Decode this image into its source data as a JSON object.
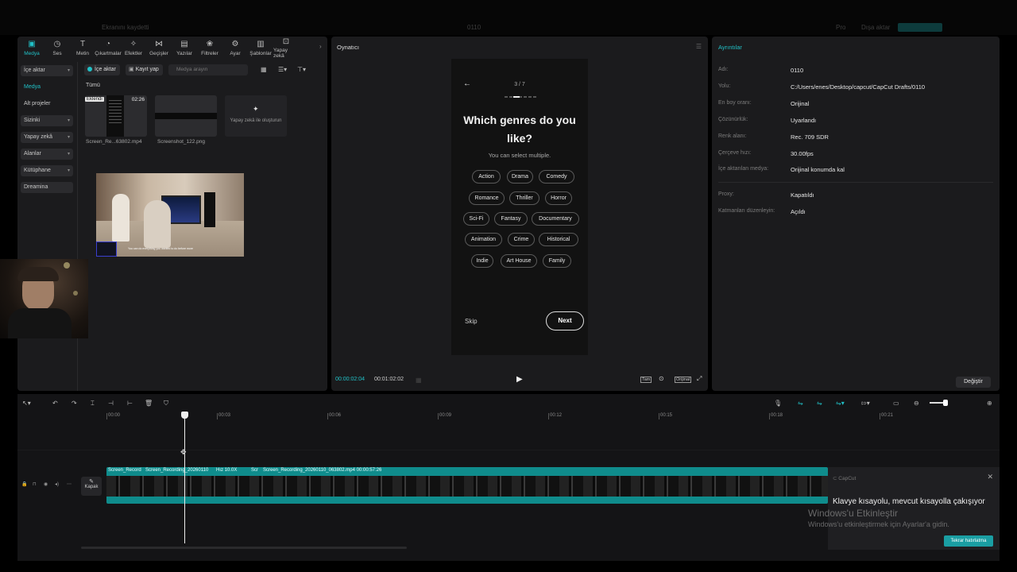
{
  "topbar": {
    "title": "Ekranını kaydetti",
    "center": "0110",
    "badge_pro": "Pro",
    "badge_two": "Dışa aktar"
  },
  "toolbar": [
    {
      "label": "Medya",
      "icon": "media-icon",
      "active": true
    },
    {
      "label": "Ses",
      "icon": "audio-icon"
    },
    {
      "label": "Metin",
      "icon": "text-icon"
    },
    {
      "label": "Çıkartmalar",
      "icon": "sticker-icon"
    },
    {
      "label": "Efektler",
      "icon": "effects-icon"
    },
    {
      "label": "Geçişler",
      "icon": "transitions-icon"
    },
    {
      "label": "Yazılar",
      "icon": "captions-icon"
    },
    {
      "label": "Filtreler",
      "icon": "filters-icon"
    },
    {
      "label": "Ayar",
      "icon": "adjust-icon"
    },
    {
      "label": "Şablonlar",
      "icon": "templates-icon"
    },
    {
      "label": "Yapay zekâ",
      "icon": "ai-icon"
    }
  ],
  "sidebar": {
    "items": [
      "İçe aktar",
      "Medya",
      "Alt projeler",
      "Sizinki",
      "Yapay zekâ",
      "Alanlar",
      "Kütüphane",
      "Dreamina"
    ]
  },
  "media": {
    "import_button": "İçe aktar",
    "record_button": "Kayıt yap",
    "search_placeholder": "Medya arayın",
    "filter_all": "Tümü",
    "item1": {
      "badge": "Eklendi",
      "duration": "02:26",
      "name": "Screen_Re...63802.mp4"
    },
    "item2": {
      "name": "Screenshot_122.png"
    },
    "ai_create": "Yapay zekâ ile oluşturun",
    "preview_caption": "You can do everything you wanted to do before more"
  },
  "player": {
    "title": "Oynatıcı",
    "time_current": "00:00:02:04",
    "time_total": "00:01:02:02",
    "full_label": "Tam",
    "ratio_label": "Orijinal"
  },
  "app_screen": {
    "step": "3 / 7",
    "title_line1": "Which genres do you",
    "title_line2": "like?",
    "subtitle": "You can select multiple.",
    "genres": [
      "Action",
      "Drama",
      "Comedy",
      "Romance",
      "Thriller",
      "Horror",
      "Sci-Fi",
      "Fantasy",
      "Documentary",
      "Animation",
      "Crime",
      "Historical",
      "Indie",
      "Art House",
      "Family"
    ],
    "skip": "Skip",
    "next": "Next"
  },
  "details": {
    "title": "Ayrıntılar",
    "rows": [
      {
        "label": "Adı:",
        "value": "0110"
      },
      {
        "label": "Yolu:",
        "value": "C:/Users/enes/Desktop/capcut/CapCut Drafts/0110"
      },
      {
        "label": "En boy oranı:",
        "value": "Orijinal"
      },
      {
        "label": "Çözünürlük:",
        "value": "Uyarlandı"
      },
      {
        "label": "Renk alanı:",
        "value": "Rec. 709 SDR"
      },
      {
        "label": "Çerçeve hızı:",
        "value": "30.00fps"
      },
      {
        "label": "İçe aktarılan medya:",
        "value": "Orijinal konumda kal"
      },
      {
        "label": "Proxy:",
        "value": "Kapatıldı"
      },
      {
        "label": "Katmanları düzenleyin:",
        "value": "Açıldı"
      }
    ],
    "change_button": "Değiştir"
  },
  "timeline": {
    "ticks": [
      "00:00",
      "00:03",
      "00:06",
      "00:09",
      "00:12",
      "00:15",
      "00:18",
      "00:21"
    ],
    "cover_label": "Kapak",
    "clips": [
      "Screen_Record",
      "Screen_Recording_20260110",
      "Hız 10.0X",
      "Scr",
      "Screen_Recording_20260110_063802.mp4  00:00:57:26"
    ]
  },
  "toast": {
    "app": "CapCut",
    "message": "Klavye kısayolu, mevcut kısayolla çakışıyor",
    "watermark1": "Windows'u Etkinleştir",
    "watermark2": "Windows'u etkinleştirmek için Ayarlar'a gidin.",
    "button": "Tekrar hatırlatma"
  },
  "colors": {
    "accent": "#21c1c7",
    "clip": "#0f8c8c",
    "panel": "#1b1b1d"
  }
}
